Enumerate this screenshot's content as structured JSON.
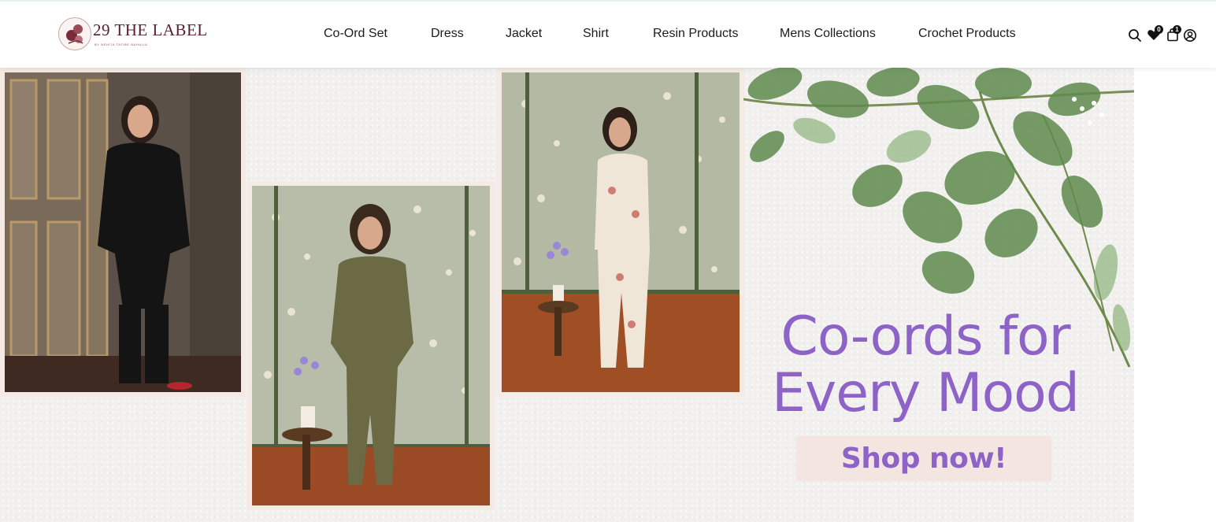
{
  "brand": {
    "name": "29 THE LABEL",
    "tagline": "BY NEHITA TATIBE BAHALIA",
    "logo_icon": "flower-monogram-icon"
  },
  "nav": {
    "items": [
      {
        "label": "Co-Ord Set"
      },
      {
        "label": "Dress"
      },
      {
        "label": "Jacket"
      },
      {
        "label": "Shirt"
      },
      {
        "label": "Resin Products"
      },
      {
        "label": "Mens Collections"
      },
      {
        "label": "Crochet Products"
      }
    ]
  },
  "header_icons": {
    "search": {
      "icon": "search-icon"
    },
    "wishlist": {
      "icon": "heart-icon",
      "count": "0"
    },
    "cart": {
      "icon": "bag-icon",
      "count": "1"
    },
    "account": {
      "icon": "user-icon"
    }
  },
  "hero": {
    "headline_line1": "Co-ords for",
    "headline_line2": "Every Mood",
    "cta_label": "Shop now!",
    "accent_color": "#8d63c7",
    "cta_bg_color": "#f3e6e0"
  }
}
